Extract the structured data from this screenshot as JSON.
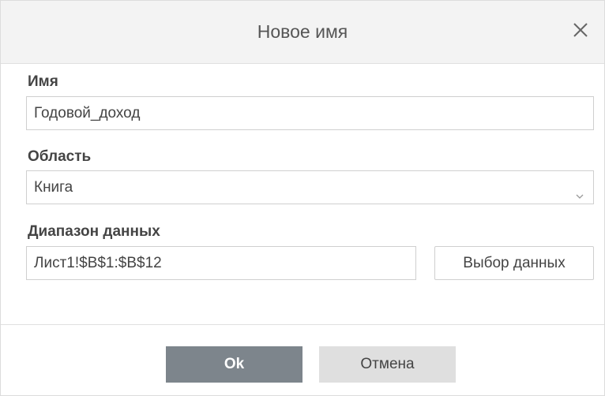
{
  "dialog": {
    "title": "Новое имя",
    "close_icon": "close-icon"
  },
  "name_field": {
    "label": "Имя",
    "value": "Годовой_доход"
  },
  "scope_field": {
    "label": "Область",
    "value": "Книга",
    "chevron_icon": "chevron-down-icon"
  },
  "range_field": {
    "label": "Диапазон данных",
    "value": "Лист1!$B$1:$B$12",
    "select_button": "Выбор данных"
  },
  "footer": {
    "ok_label": "Ok",
    "cancel_label": "Отмена"
  },
  "colors": {
    "ok_bg": "#7d858c",
    "cancel_bg": "#dfdfdf",
    "header_bg": "#f3f3f3"
  }
}
